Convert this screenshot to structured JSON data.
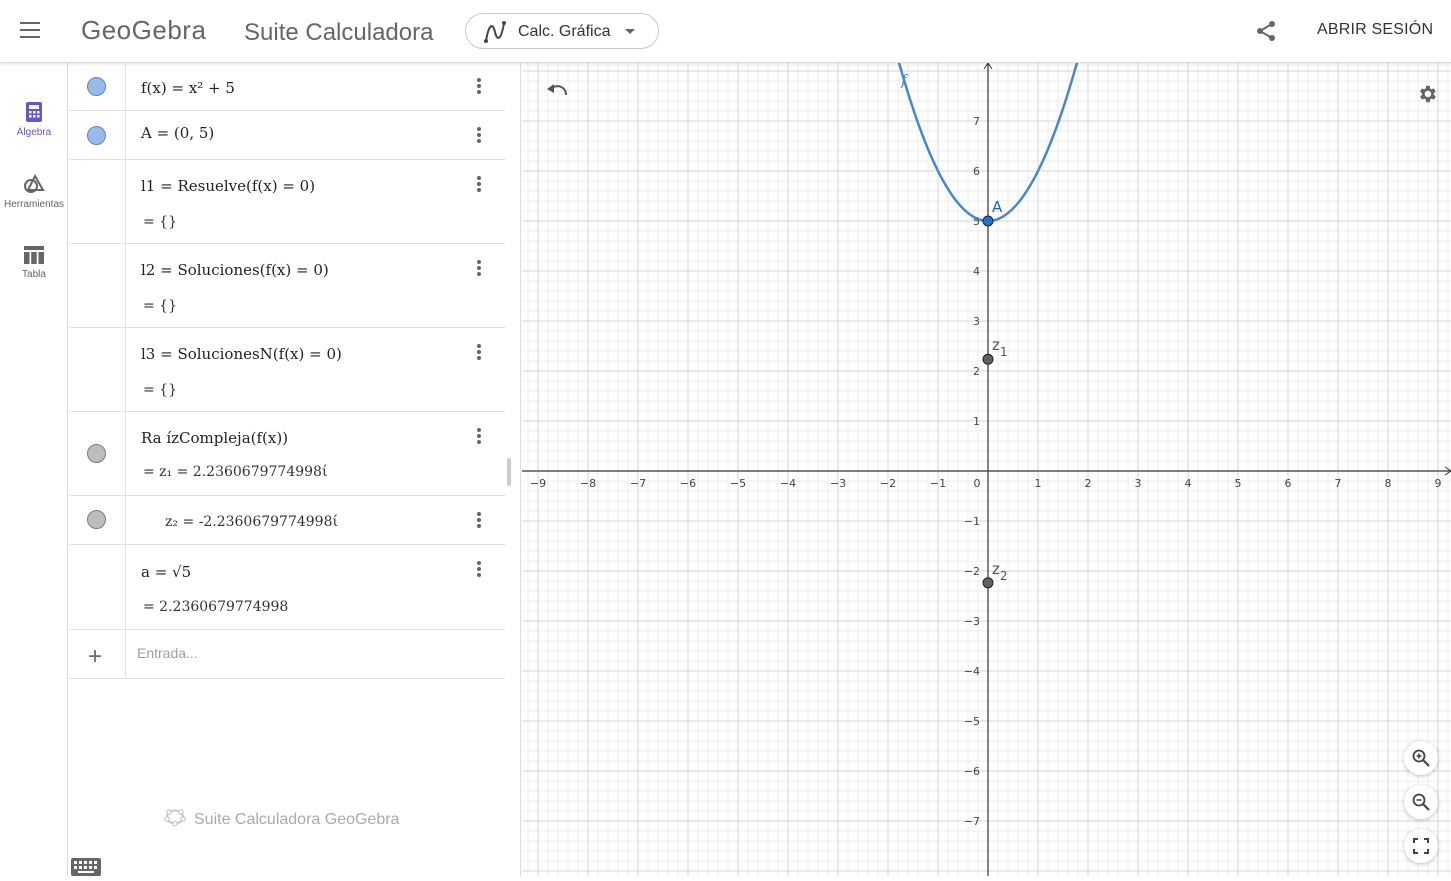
{
  "header": {
    "logo": "GeoGebra",
    "app_name": "Suite Calculadora",
    "app_switch_label": "Calc. Gráfica",
    "signin_label": "ABRIR SESIÓN"
  },
  "nav": {
    "items": [
      {
        "label": "Álgebra",
        "icon": "calculator-icon",
        "active": true
      },
      {
        "label": "Herramientas",
        "icon": "shapes-icon",
        "active": false
      },
      {
        "label": "Tabla",
        "icon": "table-icon",
        "active": false
      }
    ]
  },
  "algebra": {
    "rows": [
      {
        "expr": "f(x)  =  x² + 5",
        "dot": "blue"
      },
      {
        "expr": "A  =  (0, 5)",
        "dot": "blue"
      },
      {
        "expr": "l1  =  Resuelve(f(x)  =  0)",
        "result": "=  {}"
      },
      {
        "expr": "l2  =  Soluciones(f(x)  =  0)",
        "result": "=  {}"
      },
      {
        "expr": "l3  =  SolucionesN(f(x)  =  0)",
        "result": "=  {}"
      },
      {
        "expr": "Ra ízCompleja(f(x))",
        "result": "=  z₁ = 2.2360679774998ί",
        "dot": "gray"
      },
      {
        "expr": "z₂ = -2.2360679774998ί",
        "dot": "gray"
      },
      {
        "expr": "a  =  √5",
        "result": "=  2.2360679774998"
      }
    ],
    "input_placeholder": "Entrada...",
    "footer": "Suite Calculadora GeoGebra"
  },
  "graphics": {
    "function_label": "f",
    "points": [
      {
        "name": "A",
        "x": 0,
        "y": 5,
        "color": "#1565c0"
      },
      {
        "name": "z1",
        "label": "z",
        "sub": "1",
        "x": 0,
        "y": 2.236,
        "color": "#616161"
      },
      {
        "name": "z2",
        "label": "z",
        "sub": "2",
        "x": 0,
        "y": -2.236,
        "color": "#616161"
      }
    ],
    "x_ticks": [
      "−9",
      "−8",
      "−7",
      "−6",
      "−5",
      "−4",
      "−3",
      "−2",
      "−1",
      "0",
      "1",
      "2",
      "3",
      "4",
      "5",
      "6",
      "7",
      "8",
      "9"
    ],
    "y_ticks": [
      "7",
      "6",
      "5",
      "4",
      "3",
      "2",
      "1",
      "−1",
      "−2",
      "−3",
      "−4",
      "−5",
      "−6",
      "−7"
    ],
    "curve_color": "#4a86c8"
  }
}
